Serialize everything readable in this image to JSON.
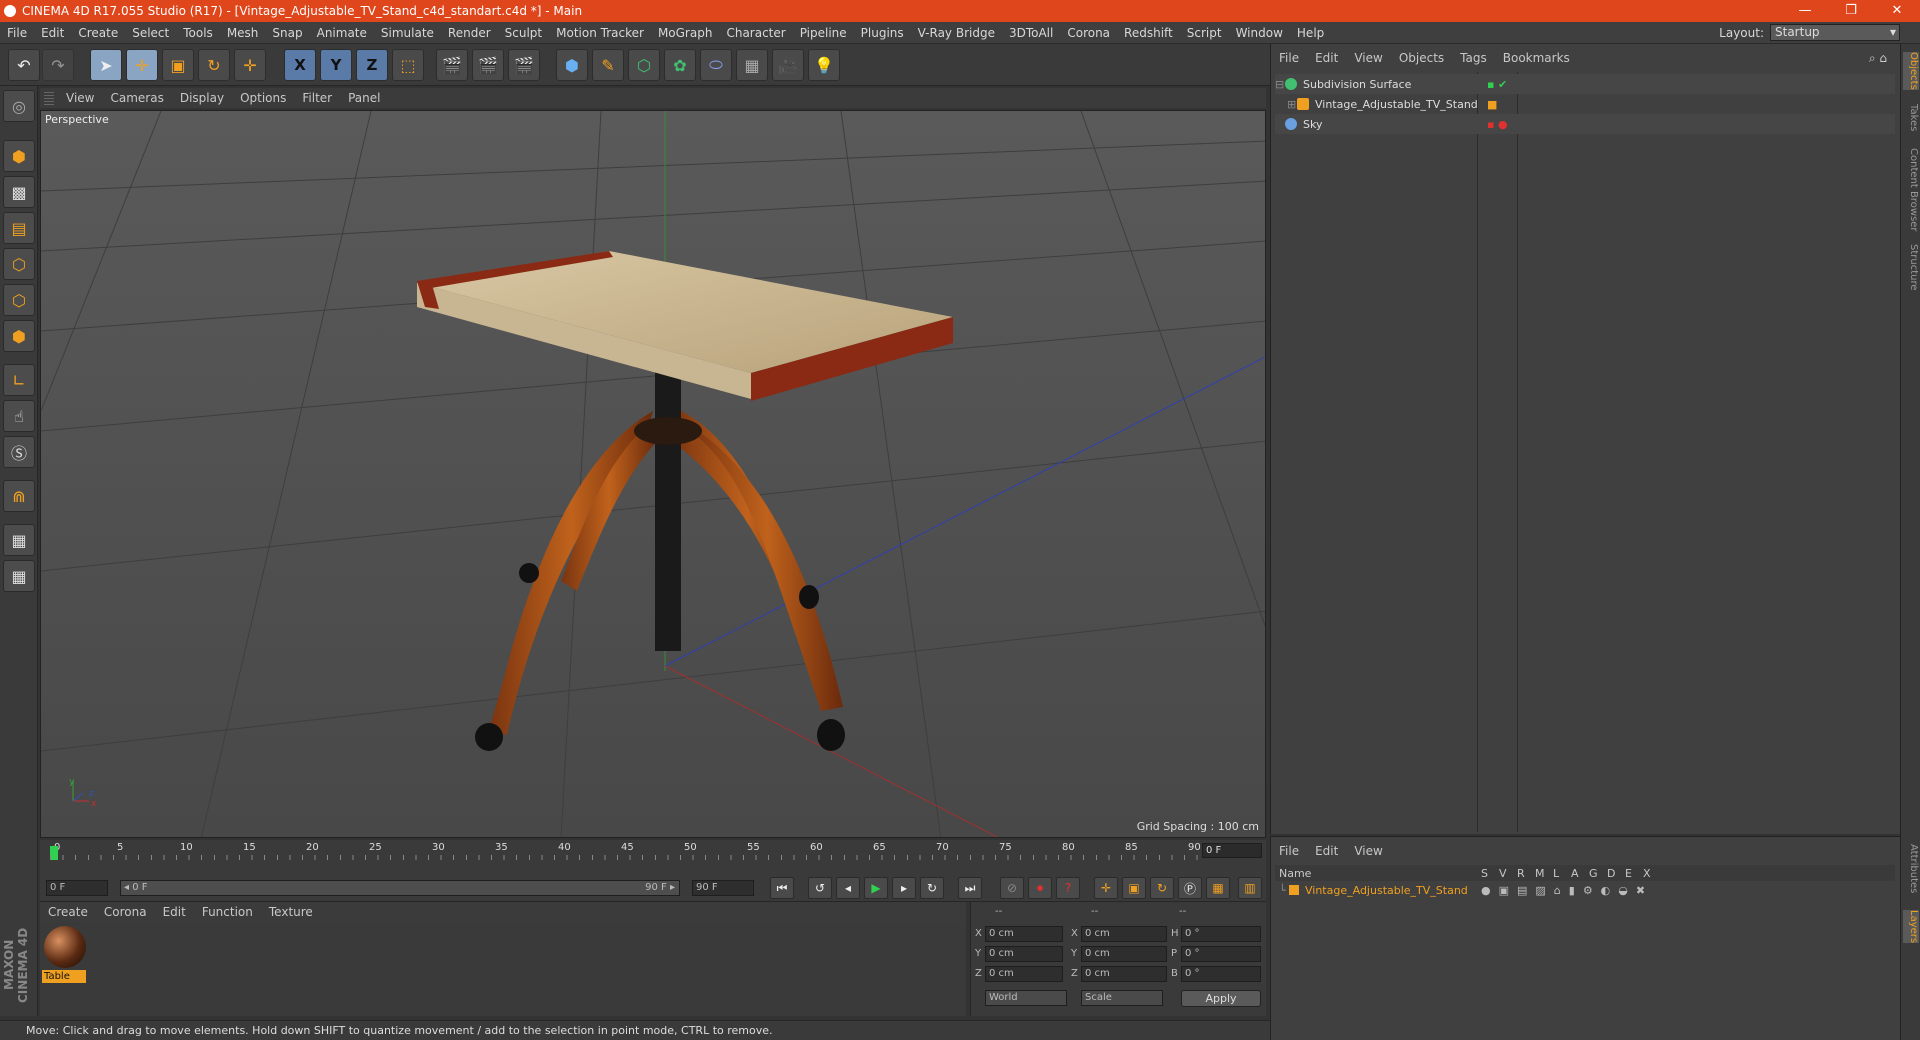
{
  "window": {
    "title": "CINEMA 4D R17.055 Studio (R17) - [Vintage_Adjustable_TV_Stand_c4d_standart.c4d *] - Main",
    "minimize": "—",
    "restore": "❐",
    "close": "✕"
  },
  "menu": [
    "File",
    "Edit",
    "Create",
    "Select",
    "Tools",
    "Mesh",
    "Snap",
    "Animate",
    "Simulate",
    "Render",
    "Sculpt",
    "Motion Tracker",
    "MoGraph",
    "Character",
    "Pipeline",
    "Plugins",
    "V-Ray Bridge",
    "3DToAll",
    "Corona",
    "Redshift",
    "Script",
    "Window",
    "Help"
  ],
  "layout": {
    "label": "Layout:",
    "value": "Startup"
  },
  "toolbar": {
    "undo": "↶",
    "redo": "↷",
    "select": "➤",
    "move": "✛",
    "scale": "▣",
    "rotate": "↻",
    "live": "✛",
    "x": "X",
    "y": "Y",
    "z": "Z"
  },
  "viewport": {
    "menu": [
      "View",
      "Cameras",
      "Display",
      "Options",
      "Filter",
      "Panel"
    ],
    "label": "Perspective",
    "grid_spacing": "Grid Spacing : 100 cm",
    "axis_y": "y",
    "axis_z": "z",
    "axis_x": "x"
  },
  "timeline": {
    "ticks": [
      "0",
      "5",
      "10",
      "15",
      "20",
      "25",
      "30",
      "35",
      "40",
      "45",
      "50",
      "55",
      "60",
      "65",
      "70",
      "75",
      "80",
      "85",
      "90"
    ],
    "current_frame": "0 F",
    "start_field": "0 F",
    "range_start": "◂ 0 F",
    "range_end": "90 F ▸",
    "end_field": "90 F"
  },
  "materials": {
    "menu": [
      "Create",
      "Corona",
      "Edit",
      "Function",
      "Texture"
    ],
    "items": [
      {
        "name": "Table"
      }
    ]
  },
  "coordinates": {
    "headers": [
      "--",
      "--",
      "--"
    ],
    "rows": [
      {
        "a": "X",
        "av": "0 cm",
        "b": "X",
        "bv": "0 cm",
        "c": "H",
        "cv": "0 °"
      },
      {
        "a": "Y",
        "av": "0 cm",
        "b": "Y",
        "bv": "0 cm",
        "c": "P",
        "cv": "0 °"
      },
      {
        "a": "Z",
        "av": "0 cm",
        "b": "Z",
        "bv": "0 cm",
        "c": "B",
        "cv": "0 °"
      }
    ],
    "mode": "World",
    "scale": "Scale",
    "apply": "Apply"
  },
  "objects": {
    "menu": [
      "File",
      "Edit",
      "View",
      "Objects",
      "Tags",
      "Bookmarks"
    ],
    "items": [
      {
        "name": "Subdivision Surface",
        "color": "#40c070"
      },
      {
        "name": "Vintage_Adjustable_TV_Stand",
        "color": "#f0a020"
      },
      {
        "name": "Sky",
        "color": "#6aa0e0"
      }
    ]
  },
  "layers": {
    "menu": [
      "File",
      "Edit",
      "View"
    ],
    "columns": [
      "Name",
      "S",
      "V",
      "R",
      "M",
      "L",
      "A",
      "G",
      "D",
      "E",
      "X"
    ],
    "row": "Vintage_Adjustable_TV_Stand"
  },
  "right_tabs": [
    "Objects",
    "Takes",
    "Content Browser",
    "Structure",
    "Attributes",
    "Layers"
  ],
  "status": "Move: Click and drag to move elements. Hold down SHIFT to quantize movement / add to the selection in point mode, CTRL to remove.",
  "brand": "MAXON CINEMA 4D",
  "colors": {
    "title_bar": "#e0461b",
    "accent": "#f0a020",
    "axis_button": "#5a7aa8"
  }
}
